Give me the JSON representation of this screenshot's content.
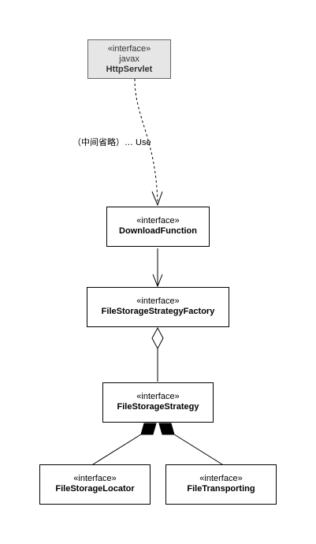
{
  "nodes": {
    "httpservlet": {
      "stereotype": "«interface»",
      "package": "javax",
      "name": "HttpServlet"
    },
    "downloadfunction": {
      "stereotype": "«interface»",
      "name": "DownloadFunction"
    },
    "factory": {
      "stereotype": "«interface»",
      "name": "FileStorageStrategyFactory"
    },
    "strategy": {
      "stereotype": "«interface»",
      "name": "FileStorageStrategy"
    },
    "locator": {
      "stereotype": "«interface»",
      "name": "FileStorageLocator"
    },
    "transporting": {
      "stereotype": "«interface»",
      "name": "FileTransporting"
    }
  },
  "edges": {
    "use_label": "（中间省略）… Use"
  },
  "colors": {
    "highlight_fill": "#e6e6e6",
    "highlight_border": "#666666",
    "line": "#000000"
  }
}
